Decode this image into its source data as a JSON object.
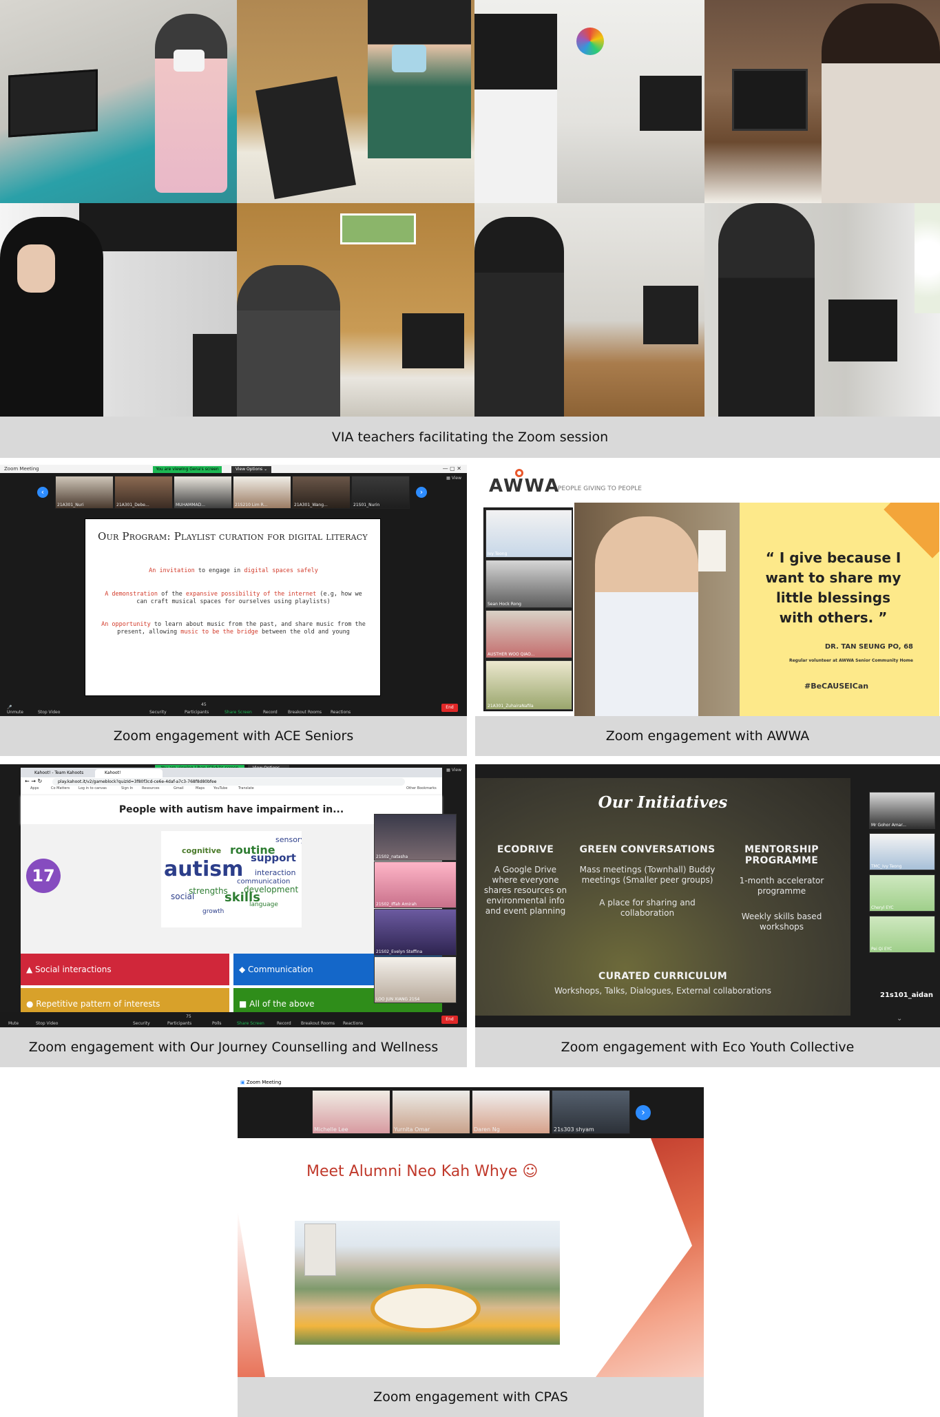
{
  "captions": {
    "via": "VIA teachers facilitating the Zoom session",
    "ace": "Zoom engagement with ACE Seniors",
    "awwa": "Zoom engagement with AWWA",
    "ojcw": "Zoom engagement with Our Journey Counselling and Wellness",
    "eyc": "Zoom engagement with Eco Youth Collective",
    "cpas": "Zoom engagement with CPAS"
  },
  "ace": {
    "window_title": "Zoom Meeting",
    "banner": "You are viewing Gena's screen",
    "view_options": "View Options",
    "view": "View",
    "thumbs": [
      "21A301_Nuri",
      "21A301_Debe...",
      "MUHAMMAD...",
      "21S210 Lim R...",
      "21A301_Wang...",
      "21S01_Nurin"
    ],
    "slide_title": "Our Program: Playlist curation for digital literacy",
    "p1": {
      "a": "An invitation",
      "b": " to engage in ",
      "c": "digital spaces safely"
    },
    "p2": {
      "a": "A demonstration",
      "b": " of the ",
      "c": "expansive possibility of the internet",
      "d": " (e.g, how we can craft musical spaces for ourselves using playlists)"
    },
    "p3": {
      "a": "An opportunity",
      "b": " to learn about music from the past, and share music from the present, allowing ",
      "c": "music to be the bridge",
      "d": " between the old and young"
    },
    "toolbar": [
      "Unmute",
      "Stop Video",
      "Security",
      "Participants",
      "Share Screen",
      "Record",
      "Breakout Rooms",
      "Reactions"
    ],
    "participants_count": "45",
    "end": "End"
  },
  "awwa": {
    "logo": "AWWA",
    "tagline": "PEOPLE GIVING TO PEOPLE",
    "quote": "I give because I want to share my little blessings with others.",
    "open_quote": "“",
    "close_quote": "”",
    "author": "DR. TAN SEUNG PO, 68",
    "role": "Regular volunteer at AWWA Senior Community Home",
    "hashtag": "#BeCAUSEICan",
    "participants": [
      "Ivy Teong",
      "Sean Hock Rong",
      "AUSTHER WOO QIAO...",
      "21A301_ZuhairaNafila"
    ]
  },
  "ojcw": {
    "tabs": [
      "Kahoot! - Team Kahoots",
      "Kahoot!"
    ],
    "banner": "You are viewing Lihan (Click)'s screen",
    "view_options": "View Options",
    "view": "View",
    "url": "play.kahoot.it/v2/gameblock?quizId=3f80f3cd-ce6e-4daf-a7c3-768f8d80bfee",
    "bookmarks": [
      "Apps",
      "Co Matters",
      "Log in to canvas",
      "Sign In",
      "Resources",
      "Gmail",
      "Maps",
      "YouTube",
      "Translate",
      "Other Bookmarks"
    ],
    "question": "People with autism have impairment in...",
    "timer": "17",
    "answers": [
      "Social interactions",
      "Communication",
      "Repetitive pattern of interests",
      "All of the above"
    ],
    "answer_colors": [
      "#d0273a",
      "#1467c9",
      "#d8a12a",
      "#2f8d1a"
    ],
    "participants": [
      "21S02_natasha",
      "21S02_Iffah Amirah",
      "21S02_Evelyn Steffina",
      "LOO JUN XIANG 21S4"
    ],
    "toolbar": [
      "Mute",
      "Stop Video",
      "Security",
      "Participants",
      "Polls",
      "Share Screen",
      "Record",
      "Breakout Rooms",
      "Reactions"
    ],
    "participants_count": "75",
    "end": "End",
    "cloud_words": [
      "cognitive",
      "autism",
      "routine",
      "support",
      "strengths",
      "skills",
      "sensory",
      "interaction",
      "communication",
      "development",
      "social",
      "language",
      "growth"
    ]
  },
  "eyc": {
    "title": "Our Initiatives",
    "cols": [
      {
        "h": "ECODRIVE",
        "p": "A Google Drive where everyone shares resources on environmental info and event planning"
      },
      {
        "h": "GREEN CONVERSATIONS",
        "p": "Mass meetings (Townhall) Buddy meetings (Smaller peer groups)",
        "p2": "A place for sharing and collaboration"
      },
      {
        "h": "MENTORSHIP PROGRAMME",
        "p": "1-month accelerator programme",
        "p2": "Weekly skills based workshops"
      }
    ],
    "curriculum_h": "CURATED CURRICULUM",
    "curriculum_p": "Workshops, Talks, Dialogues, External collaborations",
    "participants": [
      "Mr Gohor Amar...",
      "TMC_Ivy Teong",
      "Cheryl EYC",
      "Pei Qi EYC"
    ],
    "self_name": "21s101_aidan"
  },
  "cpas": {
    "window_title": "Zoom Meeting",
    "participants": [
      "Michelle Lee",
      "Yurnita Omar",
      "Daren Ng",
      "21s303 shyam"
    ],
    "slide_title": "Meet Alumni Neo Kah Whye ☺"
  }
}
